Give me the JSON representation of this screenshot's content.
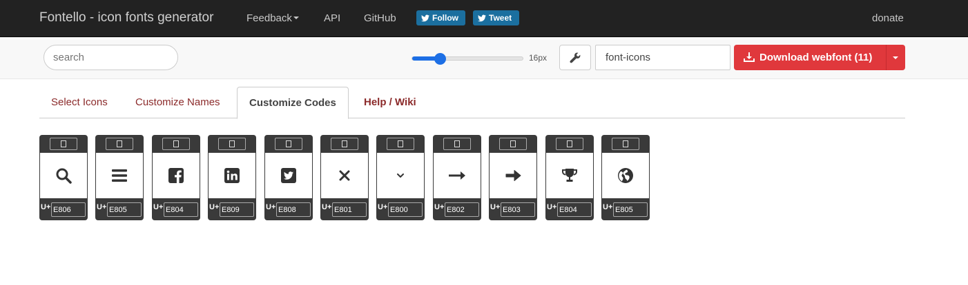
{
  "nav": {
    "brand": "Fontello - icon fonts generator",
    "feedback": "Feedback",
    "api": "API",
    "github": "GitHub",
    "follow": "Follow",
    "tweet": "Tweet",
    "donate": "donate"
  },
  "toolbar": {
    "search_placeholder": "search",
    "size_label": "16px",
    "size_fraction": 0.25,
    "font_name": "font-icons",
    "download_label": "Download webfont (11)"
  },
  "tabs": [
    {
      "label": "Select Icons",
      "active": false
    },
    {
      "label": "Customize Names",
      "active": false
    },
    {
      "label": "Customize Codes",
      "active": true
    },
    {
      "label": "Help / Wiki",
      "active": false
    }
  ],
  "glyphs": [
    {
      "icon": "search-icon",
      "prefix": "U+",
      "code": "E806"
    },
    {
      "icon": "menu-icon",
      "prefix": "U+",
      "code": "E805"
    },
    {
      "icon": "facebook-icon",
      "prefix": "U+",
      "code": "E804"
    },
    {
      "icon": "linkedin-icon",
      "prefix": "U+",
      "code": "E809"
    },
    {
      "icon": "twitter-icon",
      "prefix": "U+",
      "code": "E808"
    },
    {
      "icon": "close-icon",
      "prefix": "U+",
      "code": "E801"
    },
    {
      "icon": "chevron-down-icon",
      "prefix": "U+",
      "code": "E800"
    },
    {
      "icon": "long-arrow-right-icon",
      "prefix": "U+",
      "code": "E802"
    },
    {
      "icon": "arrow-right-icon",
      "prefix": "U+",
      "code": "E803"
    },
    {
      "icon": "trophy-icon",
      "prefix": "U+",
      "code": "E804"
    },
    {
      "icon": "globe-icon",
      "prefix": "U+",
      "code": "E805"
    }
  ],
  "colors": {
    "navbar": "#222222",
    "download": "#e0383c",
    "social": "#1b6f9f",
    "tab_link": "#8b2a2a",
    "card": "#3a3a3a"
  }
}
